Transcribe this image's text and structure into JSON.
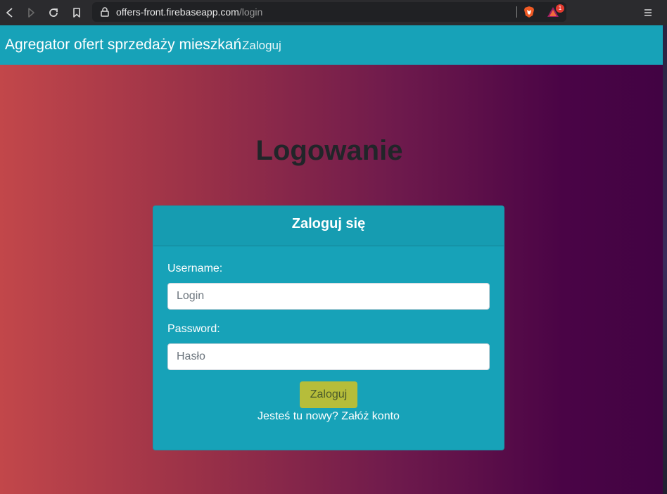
{
  "browser": {
    "url_host": "offers-front.firebaseapp.com",
    "url_path": "/login",
    "rewards_badge": "1",
    "icons": {
      "back": "back-arrow-icon",
      "forward": "forward-arrow-icon",
      "reload": "reload-icon",
      "bookmark": "bookmark-icon",
      "lock": "lock-icon",
      "brave": "brave-shields-icon",
      "rewards": "brave-rewards-icon",
      "menu": "hamburger-menu-icon"
    }
  },
  "navbar": {
    "brand": "Agregator ofert sprzedaży mieszkań",
    "link": "Zaloguj",
    "color": "#17a2b8"
  },
  "page": {
    "heading": "Logowanie"
  },
  "login_card": {
    "title": "Zaloguj się",
    "username_label": "Username:",
    "username_placeholder": "Login",
    "password_label": "Password:",
    "password_placeholder": "Hasło",
    "submit_label": "Zaloguj",
    "register_prompt": "Jesteś tu nowy?",
    "register_link": "Załóż konto",
    "submit_color": "#b6bd3a"
  }
}
